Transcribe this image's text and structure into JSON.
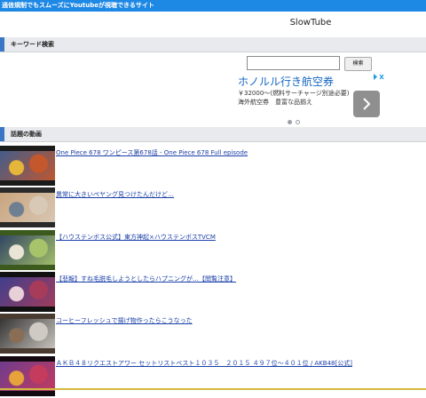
{
  "header": {
    "tagline": "通信規制でもスムーズにYoutubeが視聴できるサイト",
    "site_title": "SlowTube"
  },
  "keyword_section": {
    "heading": "キーワード検索",
    "search_value": "",
    "search_button": "検索"
  },
  "ad": {
    "close_icon": "ad-choices-close-icon",
    "title": "ホノルル行き航空券",
    "description": "￥32000～(燃料サーチャージ別途必要) 海外航空券　豊富な品揃え",
    "dots": 2,
    "active_dot": 0,
    "arrow_icon": "chevron-right-icon"
  },
  "trending_section": {
    "heading": "話題の動画"
  },
  "videos": [
    {
      "title": "One Piece 678 ワンピース第678話 - One Piece 678 Full episode",
      "thumb_colors": [
        "#1b1b1b",
        "#c4572c",
        "#e5b63a",
        "#3c5d8f"
      ]
    },
    {
      "title": "異常に大きいペヤング見つけたんだけど…",
      "thumb_colors": [
        "#2a2a2a",
        "#d8c9b6",
        "#6f7f92",
        "#c9a27a"
      ]
    },
    {
      "title": "【ハウステンボス公式】東方神起×ハウステンボスTVCM",
      "thumb_colors": [
        "#3d5a1e",
        "#a8c46a",
        "#e9e4d6",
        "#2b3f63"
      ]
    },
    {
      "title": "【悲報】すね毛脱毛しようとしたらハプニングが…【閲覧注意】",
      "thumb_colors": [
        "#111111",
        "#a63c5a",
        "#e8d0d8",
        "#3a3f8f"
      ]
    },
    {
      "title": "コーヒーフレッシュで揚げ物作ったらこうなった",
      "thumb_colors": [
        "#4a3b30",
        "#cfcac4",
        "#8a6d55",
        "#2d2d2d"
      ]
    },
    {
      "title": "ＡＫＢ４８リクエストアワー セットリストベスト１０３５　２０１５ ４９７位～４０１位 / AKB48[公式]",
      "thumb_colors": [
        "#120a10",
        "#c43b5e",
        "#e8a23c",
        "#6a3c8f"
      ]
    }
  ]
}
